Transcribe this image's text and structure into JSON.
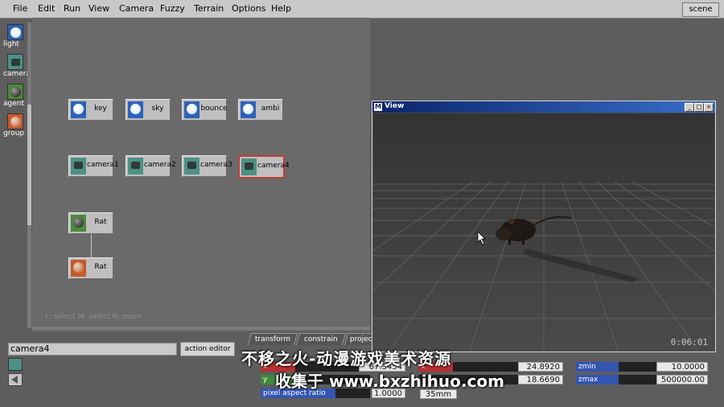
{
  "menubar": {
    "items": [
      "File",
      "Edit",
      "Run",
      "View",
      "Camera",
      "Fuzzy",
      "Terrain",
      "Options",
      "Help"
    ],
    "scene_label": "scene"
  },
  "palette": {
    "items": [
      {
        "label": "light",
        "icon": "light-icon"
      },
      {
        "label": "camera",
        "icon": "camera-icon"
      },
      {
        "label": "agent",
        "icon": "agent-icon"
      },
      {
        "label": "group",
        "icon": "group-icon"
      }
    ]
  },
  "nodes": {
    "key": "key",
    "sky": "sky",
    "bounce": "bounce",
    "ambi": "ambi",
    "camera1": "camera1",
    "camera2": "camera2",
    "camera3": "camera3",
    "camera4": "camera4",
    "rat_agent": "Rat",
    "rat_group": "Rat"
  },
  "canvas_hint": "L: select M: select R: zoom",
  "bottom": {
    "name_field": "camera4",
    "action_editor": "action editor",
    "tabs": [
      "transform",
      "constrain",
      "projec"
    ],
    "params": {
      "x_label": "x",
      "x_value": "67.3454",
      "y_label": "y",
      "pixel_aspect_label": "pixel aspect ratio",
      "pixel_aspect_value": "1.0000",
      "x2_label": "x",
      "x2_value": "24.8920",
      "y2_value": "18.6690",
      "lens_value": "35mm",
      "zmin_label": "zmin",
      "zmin_value": "10.0000",
      "zmax_label": "zmax",
      "zmax_value": "500000.00"
    }
  },
  "view_window": {
    "title": "View",
    "app_icon": "M",
    "timecode": "0:06:01"
  },
  "watermark": {
    "line1": "不移之火-动漫游戏美术资源",
    "line2": "收集于 www.bxzhihuo.com"
  },
  "colors": {
    "accent_red": "#c63a3a",
    "light_blue": "#2e61b8",
    "camera_teal": "#4e8f86",
    "agent_green": "#4b8a3b",
    "group_orange": "#c65a2a"
  }
}
